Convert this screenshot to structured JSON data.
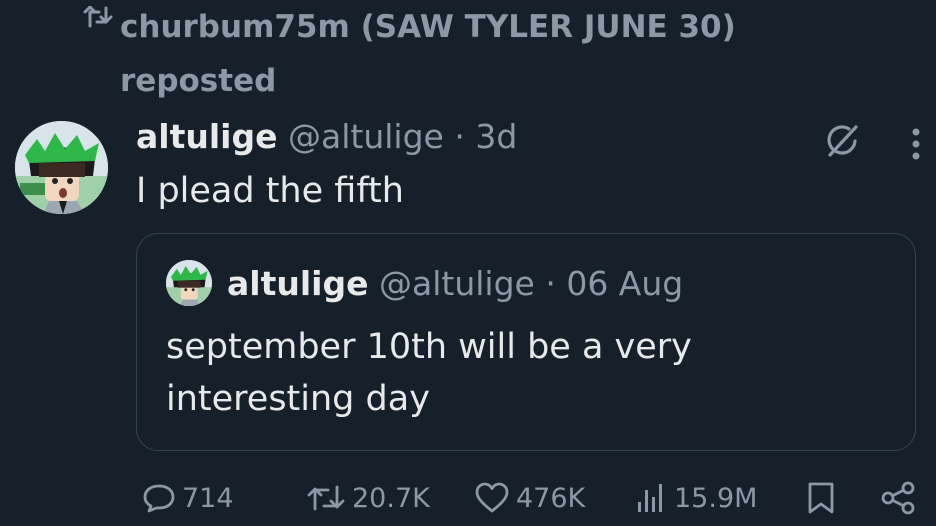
{
  "repost": {
    "text": "churbum75m (SAW TYLER JUNE 30) reposted",
    "icon": "repost-icon"
  },
  "tweet": {
    "name": "altulige",
    "handle": "@altulige",
    "separator": "·",
    "time": "3d",
    "text": "I plead the fifth",
    "grok_icon": "grok-icon",
    "more_icon": "more-icon"
  },
  "quote": {
    "name": "altulige",
    "handle": "@altulige",
    "separator": "·",
    "time": "06 Aug",
    "text": "september 10th will be a very interesting day"
  },
  "actions": {
    "replies": "714",
    "reposts": "20.7K",
    "likes": "476K",
    "views": "15.9M"
  },
  "colors": {
    "background": "#15202b",
    "text": "#e7e9ea",
    "muted": "#8b98a5",
    "border": "#38444d"
  }
}
